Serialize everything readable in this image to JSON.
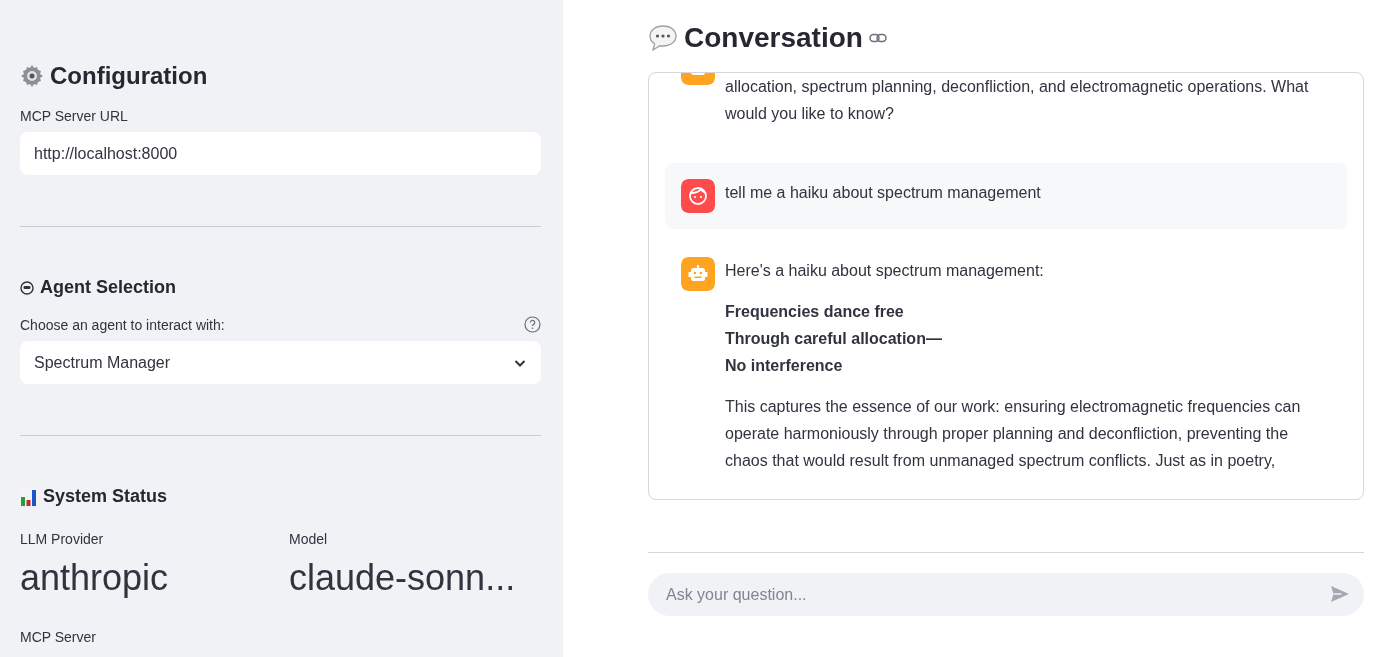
{
  "sidebar": {
    "configuration": {
      "title": "Configuration",
      "url_label": "MCP Server URL",
      "url_value": "http://localhost:8000"
    },
    "agent_selection": {
      "title": "Agent Selection",
      "label": "Choose an agent to interact with:",
      "selected_agent": "Spectrum Manager"
    },
    "system_status": {
      "title": "System Status",
      "metrics": [
        {
          "label": "LLM Provider",
          "value": "anthropic"
        },
        {
          "label": "Model",
          "value": "claude-sonn..."
        }
      ],
      "next_label": "MCP Server"
    }
  },
  "conversation": {
    "title": "Conversation",
    "messages": [
      {
        "kind": "assistant",
        "clipped_top": true,
        "paragraphs": [
          {
            "kind": "text",
            "lines": [
              "allocation, spectrum planning, deconfliction, and electromagnetic operations. What would you like to know?"
            ]
          }
        ]
      },
      {
        "kind": "user",
        "clipped_top": false,
        "paragraphs": [
          {
            "kind": "text",
            "lines": [
              "tell me a haiku about spectrum management"
            ]
          }
        ]
      },
      {
        "kind": "assistant",
        "clipped_top": false,
        "paragraphs": [
          {
            "kind": "text",
            "lines": [
              "Here's a haiku about spectrum management:"
            ]
          },
          {
            "kind": "poem",
            "lines": [
              "Frequencies dance free",
              "Through careful allocation—",
              "No interference"
            ]
          },
          {
            "kind": "text",
            "lines": [
              "This captures the essence of our work: ensuring electromagnetic frequencies can operate harmoniously through proper planning and deconfliction, preventing the chaos that would result from unmanaged spectrum conflicts. Just as in poetry,"
            ]
          }
        ]
      }
    ],
    "input": {
      "placeholder": "Ask your question..."
    }
  }
}
